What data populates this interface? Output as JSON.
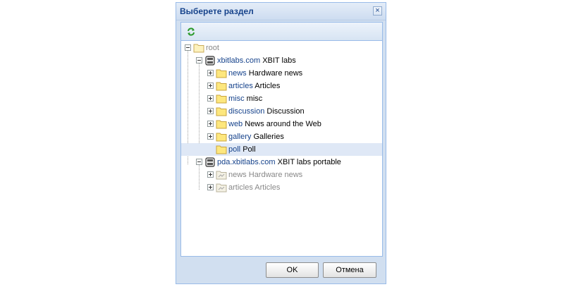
{
  "dialog": {
    "title": "Выберете раздел",
    "close_icon": "close-icon",
    "refresh_icon": "refresh-icon"
  },
  "tree": {
    "root": {
      "label": "root"
    },
    "sites": [
      {
        "name": "xbitlabs.com",
        "title": "XBIT labs",
        "expanded": true,
        "children": [
          {
            "key": "news",
            "title": "Hardware news"
          },
          {
            "key": "articles",
            "title": "Articles"
          },
          {
            "key": "misc",
            "title": "misc"
          },
          {
            "key": "discussion",
            "title": "Discussion"
          },
          {
            "key": "web",
            "title": "News around the Web"
          },
          {
            "key": "gallery",
            "title": "Galleries"
          },
          {
            "key": "poll",
            "title": "Poll",
            "selected": true
          }
        ]
      },
      {
        "name": "pda.xbitlabs.com",
        "title": "XBIT labs portable",
        "expanded": true,
        "children": [
          {
            "key": "news",
            "title": "Hardware news"
          },
          {
            "key": "articles",
            "title": "Articles"
          }
        ]
      }
    ]
  },
  "buttons": {
    "ok": "OK",
    "cancel": "Отмена"
  }
}
